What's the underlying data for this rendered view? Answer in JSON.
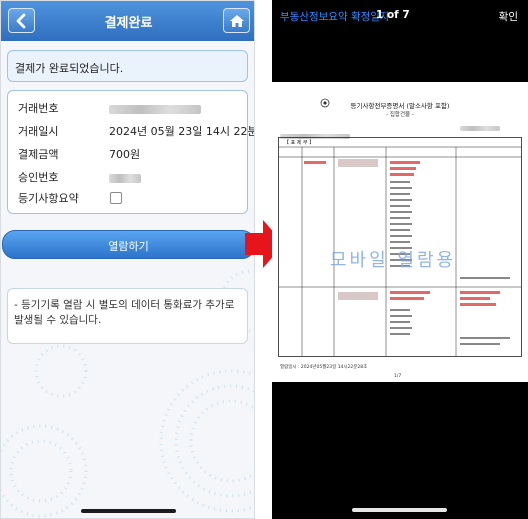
{
  "left_screen": {
    "header": {
      "title": "결제완료"
    },
    "status_message": "결제가 완료되었습니다.",
    "info_rows": [
      {
        "label": "거래번호",
        "value": ""
      },
      {
        "label": "거래일시",
        "value": "2024년 05월 23일 14시 22분"
      },
      {
        "label": "결제금액",
        "value": "700원"
      },
      {
        "label": "승인번호",
        "value": ""
      },
      {
        "label": "등기사항요약",
        "value": ""
      }
    ],
    "view_button_label": "열람하기",
    "notice": "- 등기기록 열람 시 별도의 데이터 통화료가 추가로 발생될 수 있습니다."
  },
  "right_screen": {
    "top_bar": {
      "title": "부동산정보요약   확정일자",
      "page_indicator": "1 of 7",
      "confirm_label": "확인"
    },
    "document": {
      "title": "등기사항전부증명서 (말소사항 포함)",
      "subtitle": "- 집합건물 -",
      "section_header": "【 표 제 부 】",
      "watermark": "모바일 열람용",
      "footer_left": "열람일시 : 2024년05월23일 14시22분28초",
      "page_label": "1/7"
    }
  },
  "colors": {
    "header_blue": "#3a7cc8",
    "box_border": "#9fc3e7",
    "link_blue": "#2f8cff",
    "arrow_red": "#e8141b"
  }
}
